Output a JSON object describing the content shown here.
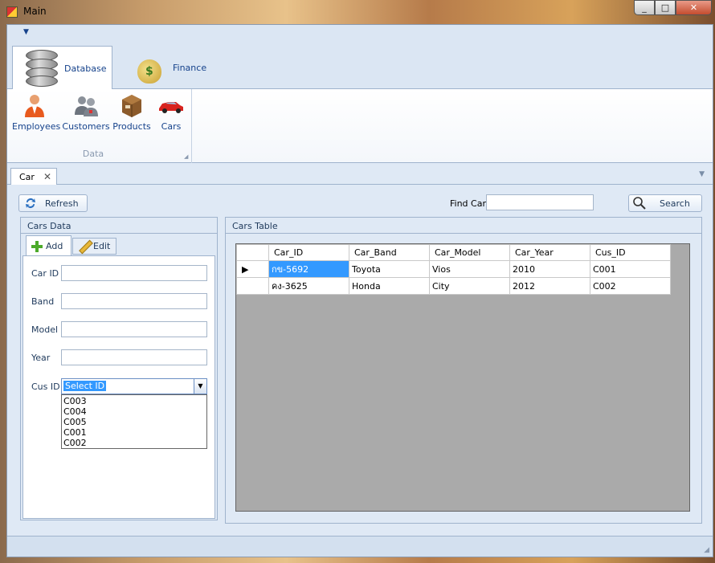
{
  "window": {
    "title": "Main"
  },
  "ribbon": {
    "tabs": [
      {
        "label": "Database",
        "icon": "database-icon",
        "active": true
      },
      {
        "label": "Finance",
        "icon": "money-bag-icon",
        "active": false
      }
    ],
    "group": {
      "label": "Data",
      "buttons": [
        {
          "label": "Employees",
          "icon": "employee-icon"
        },
        {
          "label": "Customers",
          "icon": "customers-icon"
        },
        {
          "label": "Products",
          "icon": "box-icon"
        },
        {
          "label": "Cars",
          "icon": "car-icon"
        }
      ]
    }
  },
  "doc_tab": {
    "label": "Car",
    "close": "✕"
  },
  "toolbar": {
    "refresh_label": "Refresh",
    "find_label": "Find Car",
    "find_value": "",
    "search_label": "Search"
  },
  "cars_data": {
    "title": "Cars Data",
    "tabs": {
      "add": "Add",
      "edit": "Edit"
    },
    "fields": {
      "car_id": "Car ID",
      "band": "Band",
      "model": "Model",
      "year": "Year",
      "cus_id": "Cus ID"
    },
    "cus_id_value": "Select ID",
    "cus_id_options": [
      "C003",
      "C004",
      "C005",
      "C001",
      "C002"
    ]
  },
  "cars_table": {
    "title": "Cars Table",
    "columns": [
      "Car_ID",
      "Car_Band",
      "Car_Model",
      "Car_Year",
      "Cus_ID"
    ],
    "rows": [
      [
        "กข-5692",
        "Toyota",
        "Vios",
        "2010",
        "C001"
      ],
      [
        "คง-3625",
        "Honda",
        "City",
        "2012",
        "C002"
      ]
    ],
    "current_row_marker": "▶"
  },
  "colors": {
    "ribbon_blue": "#dfe9f5",
    "selection": "#3399ff",
    "grid_background": "#aaaaaa"
  }
}
